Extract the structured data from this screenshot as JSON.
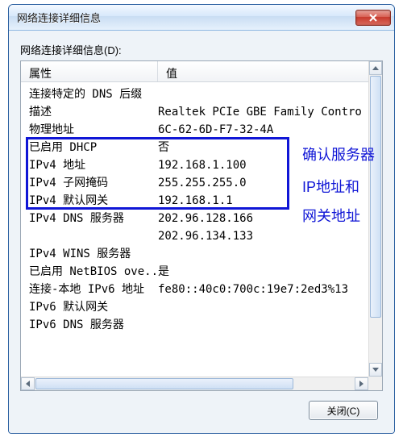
{
  "window": {
    "title": "网络连接详细信息"
  },
  "group_label": "网络连接详细信息(D):",
  "columns": {
    "property": "属性",
    "value": "值"
  },
  "rows": [
    {
      "prop": "连接特定的 DNS 后缀",
      "val": ""
    },
    {
      "prop": "描述",
      "val": "Realtek PCIe GBE Family Contro"
    },
    {
      "prop": "物理地址",
      "val": "6C-62-6D-F7-32-4A"
    },
    {
      "prop": "已启用 DHCP",
      "val": "否"
    },
    {
      "prop": "IPv4 地址",
      "val": "192.168.1.100"
    },
    {
      "prop": "IPv4 子网掩码",
      "val": "255.255.255.0"
    },
    {
      "prop": "IPv4 默认网关",
      "val": "192.168.1.1"
    },
    {
      "prop": "IPv4 DNS 服务器",
      "val": "202.96.128.166"
    },
    {
      "prop": "",
      "val": "202.96.134.133"
    },
    {
      "prop": "IPv4 WINS 服务器",
      "val": ""
    },
    {
      "prop": "已启用 NetBIOS ove...",
      "val": "是"
    },
    {
      "prop": "连接-本地 IPv6 地址",
      "val": "fe80::40c0:700c:19e7:2ed3%13"
    },
    {
      "prop": "IPv6 默认网关",
      "val": ""
    },
    {
      "prop": "IPv6 DNS 服务器",
      "val": ""
    }
  ],
  "annotation": {
    "line1": "确认服务器",
    "line2": "IP地址和",
    "line3": "网关地址"
  },
  "buttons": {
    "close": "关闭(C)"
  },
  "highlight": {
    "top_row_index": 3,
    "rows": 4
  }
}
